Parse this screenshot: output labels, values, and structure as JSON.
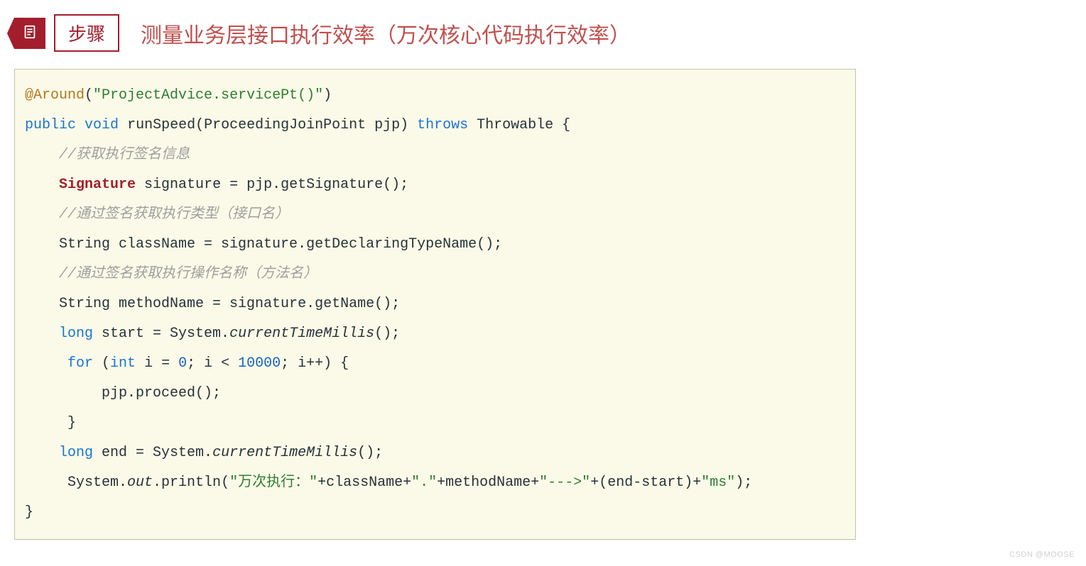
{
  "header": {
    "badge_label": "步骤",
    "title": "测量业务层接口执行效率（万次核心代码执行效率）"
  },
  "code": {
    "l1": {
      "ann": "@Around",
      "paren_open": "(",
      "str": "\"ProjectAdvice.servicePt()\"",
      "paren_close": ")"
    },
    "l2": {
      "k_public": "public",
      "k_void": "void",
      "name": "runSpeed(ProceedingJoinPoint pjp) ",
      "k_throws": "throws",
      "tail": " Throwable {"
    },
    "l3": "    //获取执行签名信息",
    "l4": {
      "indent": "    ",
      "type": "Signature",
      "tail": " signature = pjp.getSignature();"
    },
    "l5": "    //通过签名获取执行类型（接口名）",
    "l6": "    String className = signature.getDeclaringTypeName();",
    "l7": "    //通过签名获取执行操作名称（方法名）",
    "l8": "    String methodName = signature.getName();",
    "l9": {
      "indent": "    ",
      "k_long": "long",
      "mid": " start = System.",
      "method": "currentTimeMillis",
      "tail": "();"
    },
    "l10": {
      "indent": "     ",
      "k_for": "for",
      "p1": " (",
      "k_int": "int",
      "p2": " i = ",
      "n0": "0",
      "p3": "; i < ",
      "n1": "10000",
      "p4": "; i++) {"
    },
    "l11": "         pjp.proceed();",
    "l12": "     }",
    "l13": {
      "indent": "    ",
      "k_long": "long",
      "mid": " end = System.",
      "method": "currentTimeMillis",
      "tail": "();"
    },
    "l14": {
      "indent": "     System.",
      "out": "out",
      "p1": ".println(",
      "s1": "\"万次执行：\"",
      "p2": "+className+",
      "s2": "\".\"",
      "p3": "+methodName+",
      "s3": "\"--->\"",
      "p4": "+(end-start)+",
      "s4": "\"ms\"",
      "p5": ");"
    },
    "l15": "}"
  },
  "watermark": "CSDN @MOOSE"
}
